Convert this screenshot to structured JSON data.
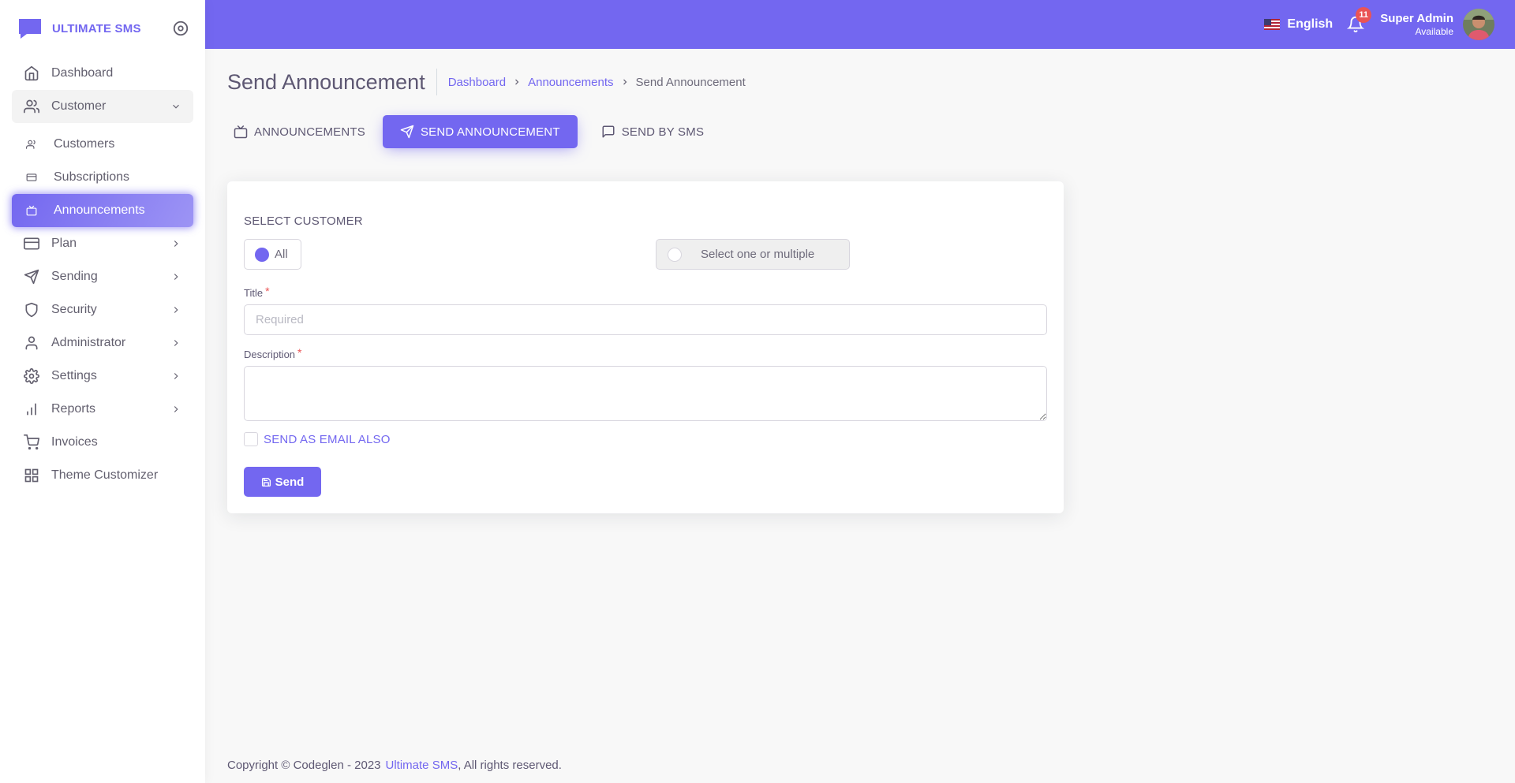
{
  "brand": {
    "name": "ULTIMATE SMS",
    "logo_icon": "chat-bubble-icon",
    "toggle_icon": "target-circle-icon"
  },
  "sidebar": {
    "items": [
      {
        "label": "Dashboard",
        "icon": "home-icon"
      },
      {
        "label": "Customer",
        "icon": "users-icon",
        "expanded": true
      },
      {
        "label": "Customers",
        "icon": "users-small-icon",
        "sub": true
      },
      {
        "label": "Subscriptions",
        "icon": "card-small-icon",
        "sub": true
      },
      {
        "label": "Announcements",
        "icon": "tv-small-icon",
        "sub": true,
        "active": true
      },
      {
        "label": "Plan",
        "icon": "credit-card-icon"
      },
      {
        "label": "Sending",
        "icon": "send-icon"
      },
      {
        "label": "Security",
        "icon": "shield-icon"
      },
      {
        "label": "Administrator",
        "icon": "user-icon"
      },
      {
        "label": "Settings",
        "icon": "gear-icon"
      },
      {
        "label": "Reports",
        "icon": "bar-chart-icon"
      },
      {
        "label": "Invoices",
        "icon": "shopping-cart-icon"
      },
      {
        "label": "Theme Customizer",
        "icon": "grid-icon"
      }
    ]
  },
  "navbar": {
    "language": "English",
    "notification_count": "11",
    "user_name": "Super Admin",
    "user_status": "Available",
    "accent": "#7367f0"
  },
  "page": {
    "title": "Send Announcement",
    "breadcrumb": [
      "Dashboard",
      "Announcements",
      "Send Announcement"
    ]
  },
  "tabs": [
    {
      "label": "ANNOUNCEMENTS",
      "icon": "tv-icon"
    },
    {
      "label": "SEND ANNOUNCEMENT",
      "icon": "send-icon",
      "active": true
    },
    {
      "label": "SEND BY SMS",
      "icon": "message-square-icon"
    }
  ],
  "form": {
    "select_customer_label": "SELECT CUSTOMER",
    "option_all": "All",
    "option_multiple": "Select one or multiple",
    "title_label": "Title",
    "title_placeholder": "Required",
    "title_value": "",
    "description_label": "Description",
    "description_value": "",
    "required_mark": "*",
    "send_email_label": "SEND AS EMAIL ALSO",
    "send_email_checked": false,
    "submit_label": "Send"
  },
  "footer": {
    "copyright": "Copyright © Codeglen - 2023",
    "link": "Ultimate SMS",
    "suffix": ", All rights reserved."
  }
}
